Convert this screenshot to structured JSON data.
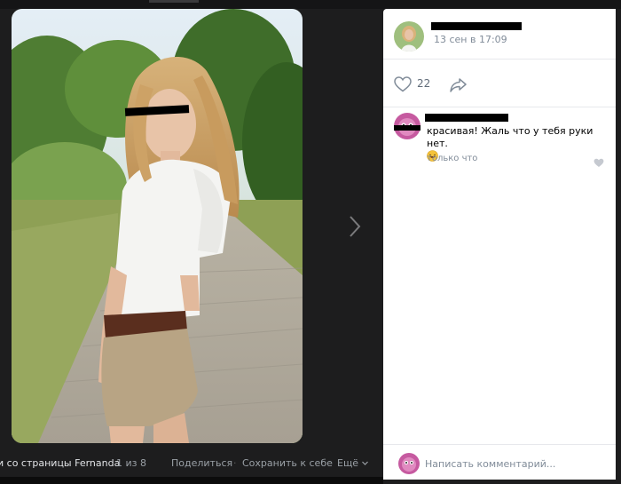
{
  "viewer": {
    "album_title": "и со страницы Fernanda",
    "counter": "1 из 8",
    "actions": {
      "share": "Поделиться",
      "save": "Сохранить к себе",
      "more": "Ещё"
    },
    "separator": "·"
  },
  "post": {
    "date": "13 сен в 17:09",
    "likes": "22"
  },
  "comments": [
    {
      "text": "красивая! Жаль что у тебя руки нет.",
      "time": "только что"
    }
  ],
  "comment_input": {
    "placeholder": "Написать комментарий..."
  },
  "colors": {
    "panel_bg": "#ffffff",
    "viewer_bg": "#1d1d1e",
    "muted_text": "#818c99",
    "link_blue": "#5181b8"
  }
}
